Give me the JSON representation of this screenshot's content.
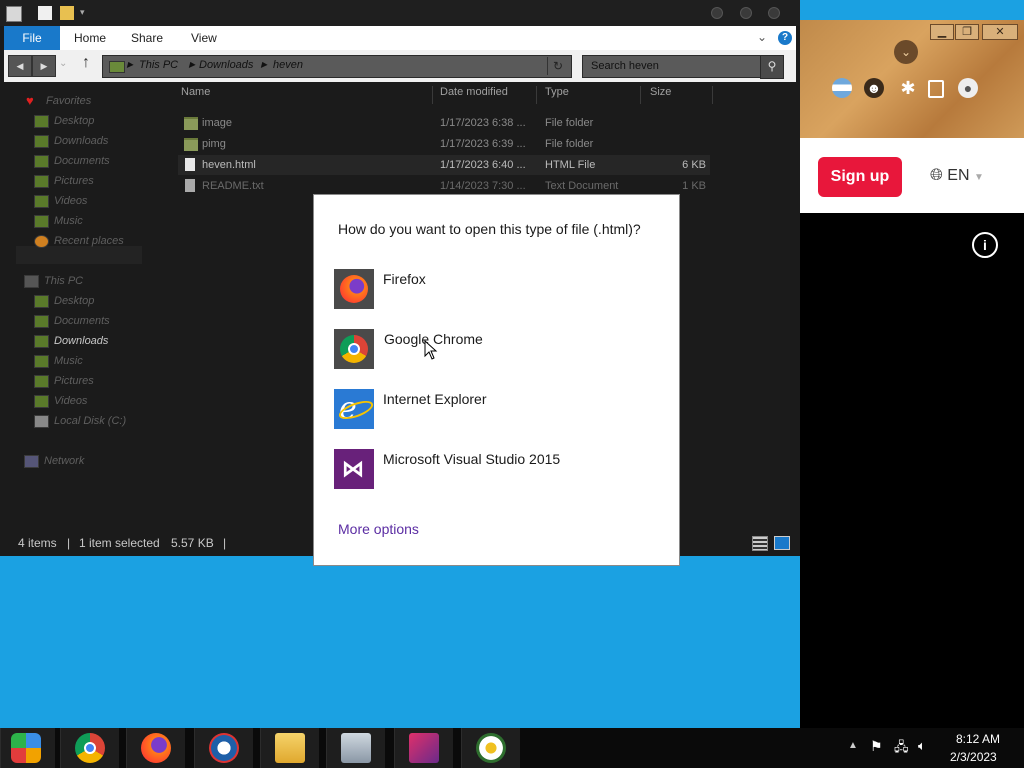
{
  "browser": {
    "signup_label": "Sign up",
    "lang_label": "EN",
    "window_controls": [
      "minimize-icon",
      "maximize-icon",
      "close-icon"
    ]
  },
  "explorer": {
    "ribbon_tabs": [
      "File",
      "Home",
      "Share",
      "View"
    ],
    "address": [
      "This PC",
      "Downloads",
      "heven"
    ],
    "search_placeholder": "Search heven",
    "nav": [
      {
        "label": "Favorites",
        "icon": "favorites-heart-icon"
      },
      {
        "label": "Desktop",
        "icon": "desktop-icon"
      },
      {
        "label": "Downloads",
        "icon": "downloads-icon"
      },
      {
        "label": "Documents",
        "icon": "documents-icon"
      },
      {
        "label": "Pictures",
        "icon": "pictures-icon"
      },
      {
        "label": "Videos",
        "icon": "videos-icon"
      },
      {
        "label": "Music",
        "icon": "music-icon"
      },
      {
        "label": "Recent places",
        "icon": "recent-places-icon"
      },
      {
        "label": "This PC",
        "icon": "computer-icon"
      },
      {
        "label": "Desktop",
        "icon": "desktop-icon"
      },
      {
        "label": "Documents",
        "icon": "documents-icon"
      },
      {
        "label": "Downloads",
        "icon": "downloads-icon"
      },
      {
        "label": "Music",
        "icon": "music-icon"
      },
      {
        "label": "Pictures",
        "icon": "pictures-icon"
      },
      {
        "label": "Videos",
        "icon": "videos-icon"
      },
      {
        "label": "Local Disk (C:)",
        "icon": "local-disk-icon"
      },
      {
        "label": "Network",
        "icon": "network-icon"
      }
    ],
    "columns": [
      "Name",
      "Date modified",
      "Type",
      "Size"
    ],
    "files": [
      {
        "name": "image",
        "date": "1/17/2023 6:38 ...",
        "type": "File folder",
        "size": ""
      },
      {
        "name": "pimg",
        "date": "1/17/2023 6:39 ...",
        "type": "File folder",
        "size": ""
      },
      {
        "name": "heven.html",
        "date": "1/17/2023 6:40 ...",
        "type": "HTML File",
        "size": "6 KB"
      },
      {
        "name": "README.txt",
        "date": "1/14/2023 7:30 ...",
        "type": "Text Document",
        "size": "1 KB"
      }
    ],
    "status": {
      "items": "4 items",
      "sep": "|",
      "selected": "1 item selected",
      "size": "5.57 KB"
    }
  },
  "dialog": {
    "title": "How do you want to open this type of file (.html)?",
    "apps": [
      "Firefox",
      "Google Chrome",
      "Internet Explorer",
      "Microsoft Visual Studio 2015"
    ],
    "more_options": "More options"
  },
  "taskbar": {
    "time": "8:12 AM",
    "date": "2/3/2023"
  },
  "colors": {
    "desktop": "#1ba1e2",
    "file_tab": "#1979ca",
    "signup": "#e8173b",
    "more_options": "#5b2da3"
  }
}
